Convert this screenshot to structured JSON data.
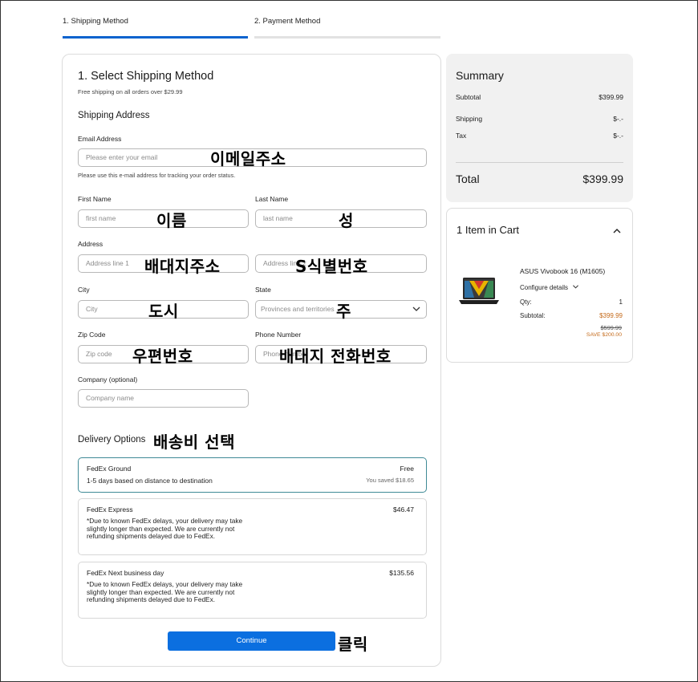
{
  "stepper": {
    "step1": "1. Shipping Method",
    "step2": "2. Payment Method"
  },
  "form": {
    "title": "1. Select Shipping Method",
    "subtitle": "Free shipping on all orders over $29.99",
    "section": "Shipping Address",
    "email": {
      "label": "Email Address",
      "placeholder": "Please enter your email",
      "help": "Please use this e-mail address for tracking your order status.",
      "note": "이메일주소"
    },
    "first_name": {
      "label": "First Name",
      "placeholder": "first name",
      "note": "이름"
    },
    "last_name": {
      "label": "Last Name",
      "placeholder": "last name",
      "note": "성"
    },
    "address": {
      "label": "Address",
      "placeholder1": "Address line 1",
      "placeholder2": "Address line 2",
      "note1": "배대지주소",
      "note2": "S식별번호"
    },
    "city": {
      "label": "City",
      "placeholder": "City",
      "note": "도시"
    },
    "state": {
      "label": "State",
      "placeholder": "Provinces and territories",
      "note": "주"
    },
    "zip": {
      "label": "Zip Code",
      "placeholder": "Zip code",
      "note": "우편번호"
    },
    "phone": {
      "label": "Phone Number",
      "placeholder": "Phone number",
      "note": "배대지 전화번호"
    },
    "company": {
      "label": "Company (optional)",
      "placeholder": "Company name"
    },
    "delivery": {
      "label": "Delivery Options",
      "note": "배송비 선택",
      "options": [
        {
          "title": "FedEx Ground",
          "price": "Free",
          "desc": "1-5 days based on distance to destination",
          "saved": "You saved  $18.65"
        },
        {
          "title": "FedEx Express",
          "price": "$46.47",
          "desc": "*Due to known FedEx delays, your delivery may take slightly longer than expected. We are currently not refunding shipments delayed due to FedEx."
        },
        {
          "title": "FedEx Next business day",
          "price": "$135.56",
          "desc": "*Due to known FedEx delays, your delivery may take slightly longer than expected. We are currently not refunding shipments delayed due to FedEx."
        }
      ]
    },
    "continue": "Continue",
    "continue_note": "클릭"
  },
  "summary": {
    "title": "Summary",
    "subtotal_label": "Subtotal",
    "subtotal": "$399.99",
    "shipping_label": "Shipping",
    "shipping": "$-.-",
    "tax_label": "Tax",
    "tax": "$-.-",
    "total_label": "Total",
    "total": "$399.99"
  },
  "cart": {
    "title": "1 Item in Cart",
    "product": "ASUS Vivobook 16 (M1605)",
    "configure": "Configure details",
    "qty_label": "Qty:",
    "qty": "1",
    "subtotal_label": "Subtotal:",
    "subtotal": "$399.99",
    "original": "$599.99",
    "save": "SAVE $200.00"
  },
  "colors": {
    "accent": "#0b63ce",
    "selected_border": "#3f8a96",
    "price_orange": "#c46a1a"
  }
}
